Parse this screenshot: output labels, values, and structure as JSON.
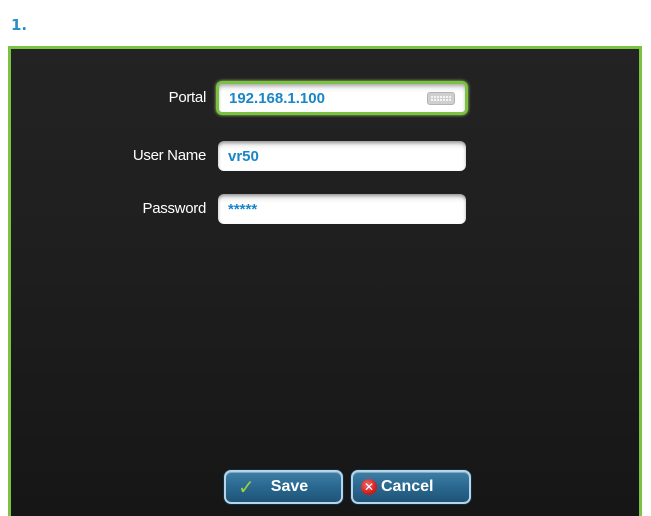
{
  "step": {
    "number": "1."
  },
  "form": {
    "portal": {
      "label": "Portal",
      "value": "192.168.1.100"
    },
    "username": {
      "label": "User Name",
      "value": "vr50"
    },
    "password": {
      "label": "Password",
      "value": "*****"
    }
  },
  "buttons": {
    "save": "Save",
    "cancel": "Cancel"
  },
  "icons": {
    "keyboard": "keyboard-icon",
    "save": "checkmark-icon",
    "cancel": "x-icon"
  },
  "colors": {
    "accent_green": "#7bc142",
    "text_blue": "#1a86c7",
    "panel_bg": "#1e1e1e",
    "button_blue": "#2b6a92"
  }
}
